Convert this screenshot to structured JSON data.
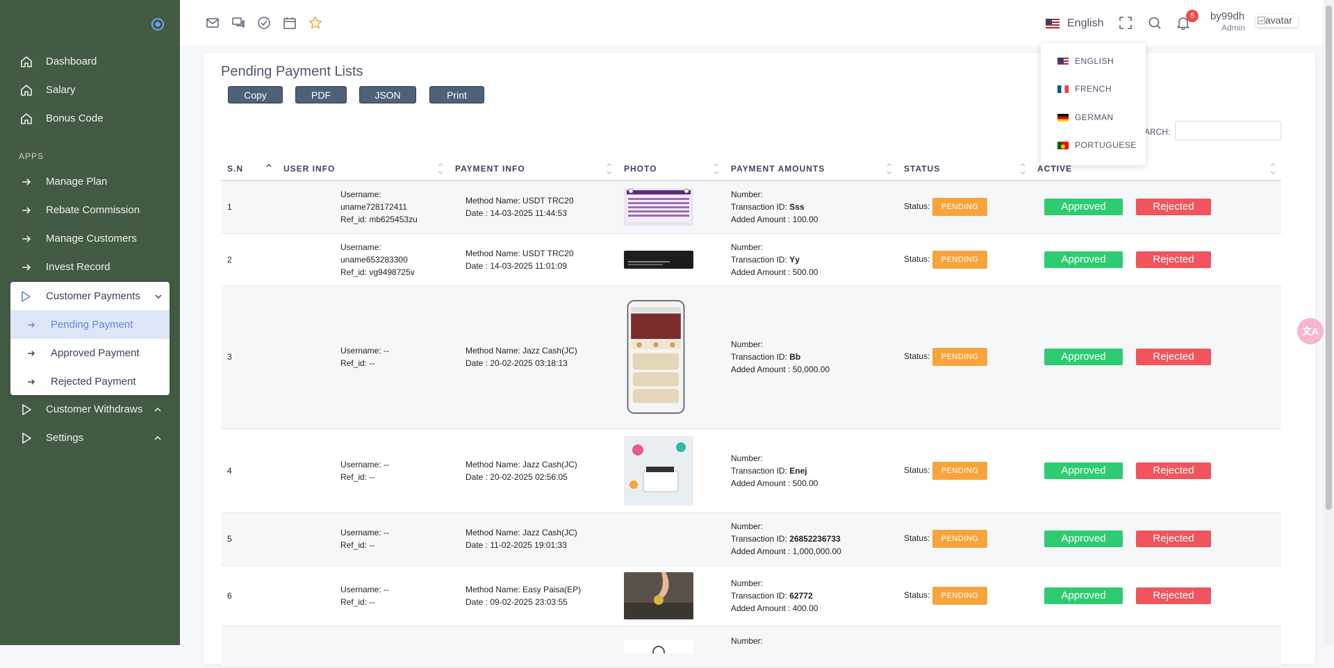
{
  "sidebar": {
    "items": [
      {
        "label": "Dashboard"
      },
      {
        "label": "Salary"
      },
      {
        "label": "Bonus Code"
      }
    ],
    "section_label": "APPS",
    "apps": [
      {
        "label": "Manage Plan"
      },
      {
        "label": "Rebate Commission"
      },
      {
        "label": "Manage Customers"
      },
      {
        "label": "Invest Record"
      }
    ],
    "customer_payments": {
      "label": "Customer Payments",
      "sub": [
        {
          "label": "Pending Payment"
        },
        {
          "label": "Approved Payment"
        },
        {
          "label": "Rejected Payment"
        }
      ]
    },
    "customer_withdraws": {
      "label": "Customer Withdraws"
    },
    "settings": {
      "label": "Settings"
    }
  },
  "topbar": {
    "language": "English",
    "notification_count": "5",
    "user_name": "by99dh",
    "user_role": "Admin",
    "avatar_alt": "avatar"
  },
  "language_menu": [
    {
      "label": "ENGLISH"
    },
    {
      "label": "FRENCH"
    },
    {
      "label": "GERMAN"
    },
    {
      "label": "PORTUGUESE"
    }
  ],
  "page": {
    "title": "Pending Payment Lists",
    "export_buttons": [
      "Copy",
      "PDF",
      "JSON",
      "Print"
    ],
    "search_label": "ARCH:"
  },
  "table": {
    "columns": [
      "S.N",
      "USER INFO",
      "PAYMENT INFO",
      "PHOTO",
      "PAYMENT AMOUNTS",
      "STATUS",
      "ACTIVE"
    ],
    "labels": {
      "username": "Username: ",
      "ref_id": "Ref_id: ",
      "method": "Method Name: ",
      "date": "Date : ",
      "number": "Number:",
      "txn": "Transaction ID: ",
      "amount": "Added Amount : ",
      "status": "Status: ",
      "approve": "Approved",
      "reject": "Rejected"
    },
    "rows": [
      {
        "sn": "1",
        "username": "uname728172411",
        "ref_id": "mb625453zu",
        "method": "USDT TRC20",
        "date": "14-03-2025 11:44:53",
        "txn": "Sss",
        "amount": "100.00",
        "status": "PENDING"
      },
      {
        "sn": "2",
        "username": "uname653283300",
        "ref_id": "vg9498725v",
        "method": "USDT TRC20",
        "date": "14-03-2025 11:01:09",
        "txn": "Yy",
        "amount": "500.00",
        "status": "PENDING"
      },
      {
        "sn": "3",
        "username": "--",
        "ref_id": "--",
        "method": "Jazz Cash(JC)",
        "date": "20-02-2025 03:18:13",
        "txn": "Bb",
        "amount": "50,000.00",
        "status": "PENDING"
      },
      {
        "sn": "4",
        "username": "--",
        "ref_id": "--",
        "method": "Jazz Cash(JC)",
        "date": "20-02-2025 02:56:05",
        "txn": "Enej",
        "amount": "500.00",
        "status": "PENDING"
      },
      {
        "sn": "5",
        "username": "--",
        "ref_id": "--",
        "method": "Jazz Cash(JC)",
        "date": "11-02-2025 19:01:33",
        "txn": "26852236733",
        "amount": "1,000,000.00",
        "status": "PENDING"
      },
      {
        "sn": "6",
        "username": "--",
        "ref_id": "--",
        "method": "Easy Paisa(EP)",
        "date": "09-02-2025 23:03:55",
        "txn": "62772",
        "amount": "400.00",
        "status": "PENDING"
      },
      {
        "sn": "",
        "username": "",
        "ref_id": "",
        "method": "",
        "date": "",
        "txn": "",
        "amount": "",
        "status": ""
      }
    ],
    "partial_row": {
      "number": "Number:"
    }
  },
  "colors": {
    "sidebar_bg": "#445b43",
    "button_bg": "#4e6178",
    "pending": "#f7a43d",
    "approve": "#2ecc71",
    "reject": "#f1545c",
    "active_item": "#6b84d6"
  },
  "icons": {
    "top": [
      "mail-icon",
      "chat-icon",
      "check-circle-icon",
      "calendar-icon",
      "star-icon"
    ],
    "right": [
      "fullscreen-icon",
      "search-icon",
      "bell-icon"
    ]
  }
}
